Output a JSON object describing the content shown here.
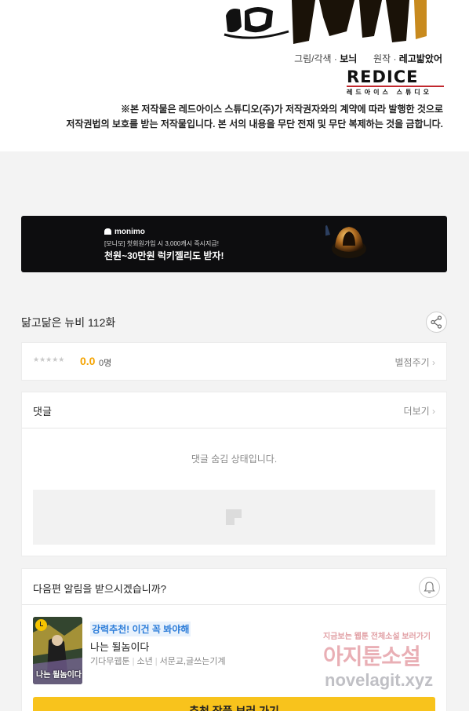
{
  "credits": {
    "art_label": "그림/각색",
    "art_name": "보늬",
    "original_label": "원작",
    "original_name": "레고밟았어",
    "studio_logo_text": "REDICE",
    "studio_sub": "레드아이스 스튜디오",
    "copyright_line1": "※본 저작물은 레드아이스 스튜디오(주)가 저작권자와의 계약에 따라 발행한 것으로",
    "copyright_line2": "저작권법의 보호를 받는 저작물입니다. 본 서의 내용을 무단 전재 및 무단 복제하는 것을 금합니다."
  },
  "ad": {
    "brand": "monimo",
    "small_text": "[모니모] 첫회원가입 시 3,000캐시 즉시지급!",
    "headline": "천원~30만원 럭키젤리도 받자!"
  },
  "episode": {
    "title": "닮고닮은 뉴비 112화"
  },
  "rating": {
    "stars": "★★★★★",
    "score": "0.0",
    "count": "0명",
    "rate_link": "별점주기"
  },
  "comments": {
    "title": "댓글",
    "more": "더보기",
    "hidden_message": "댓글 숨김 상태입니다."
  },
  "notify": {
    "question": "다음편 알림을 받으시겠습니까?"
  },
  "recommend": {
    "badge": "강력추천! 이건 꼭 봐야해",
    "title": "나는 될놈이다",
    "meta": [
      "기다무웹툰",
      "소년",
      "서문교,글쓰는기계"
    ],
    "thumb_title": "나는 될놈이다",
    "cta_label": "추천 작품 보러 가기"
  },
  "watermark": {
    "line1": "지금보는 웹툰 전체소설 보러가기",
    "line2": "아지툰소설",
    "line3": "novelagit.xyz"
  },
  "colors": {
    "accent_yellow": "#f8c31c",
    "score_orange": "#f4a300",
    "badge_blue": "#2b7cd9"
  }
}
